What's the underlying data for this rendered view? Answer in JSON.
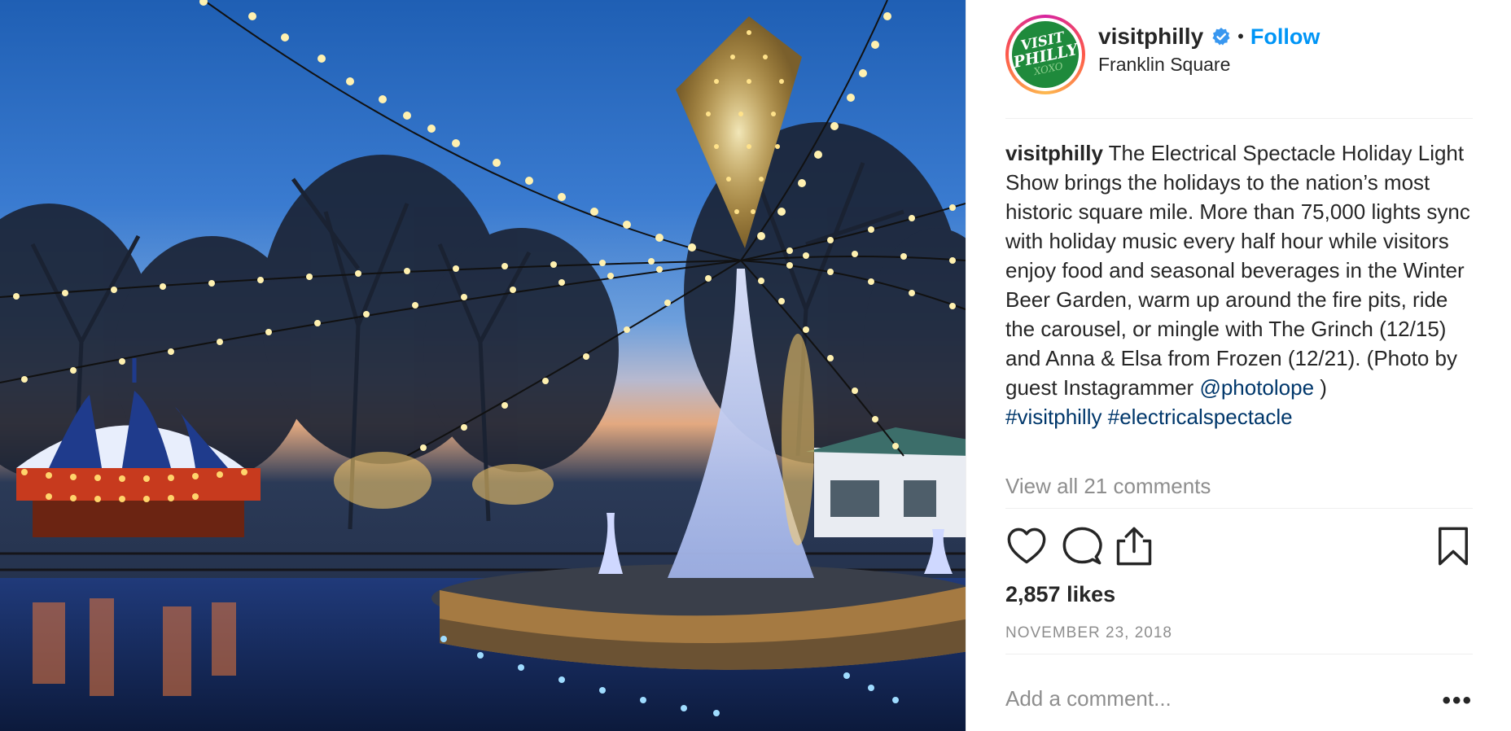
{
  "post": {
    "photo_alt": "Holiday light display with fountain and carousel at Franklin Square",
    "header": {
      "username": "visitphilly",
      "verified": true,
      "separator": "•",
      "follow_label": "Follow",
      "location": "Franklin Square",
      "avatar": {
        "line1": "VISIT",
        "line2": "PHILLY",
        "line3": "XOXO"
      }
    },
    "caption": {
      "username": "visitphilly",
      "text": " The Electrical Spectacle Holiday Light Show brings the holidays to the nation’s most historic square mile. More than 75,000 lights sync with holiday music every half hour while visitors enjoy food and seasonal beverages in the Winter Beer Garden, warm up around the fire pits, ride the carousel, or mingle with The Grinch (12/15) and Anna & Elsa from Frozen (12/21). (Photo by guest Instagrammer ",
      "mention": "@photolope",
      "after_mention": " )",
      "hashtag1": "#visitphilly",
      "hashtag2": "#electricalspectacle"
    },
    "view_comments": "View all 21 comments",
    "likes": "2,857 likes",
    "date": "NOVEMBER 23, 2018",
    "comment_placeholder": "Add a comment...",
    "more_label": "•••"
  },
  "icons": [
    "heart-icon",
    "comment-icon",
    "share-icon",
    "bookmark-icon",
    "verified-badge-icon"
  ],
  "colors": {
    "link": "#0095f6",
    "hashtag": "#00376b",
    "muted": "#8e8e8e",
    "text": "#262626",
    "verified": "#3897f0"
  }
}
